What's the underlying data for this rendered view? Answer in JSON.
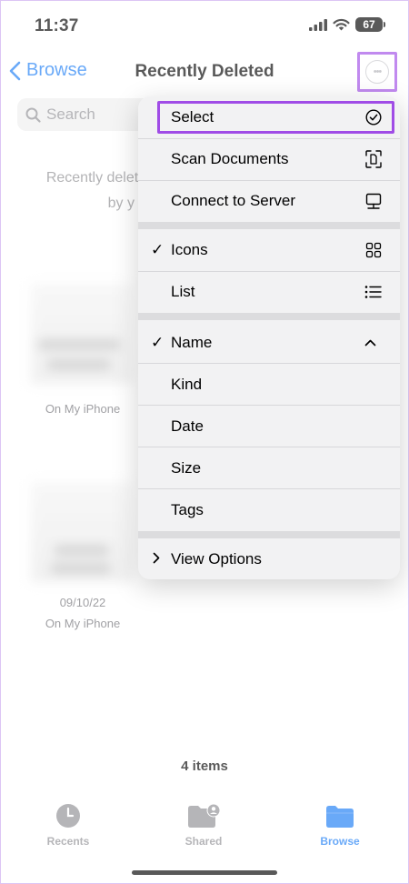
{
  "status": {
    "time": "11:37",
    "battery": "67"
  },
  "nav": {
    "back_label": "Browse",
    "title": "Recently Deleted"
  },
  "search": {
    "placeholder": "Search"
  },
  "background": {
    "info_line1": "Recently deleted",
    "info_line2": "by y",
    "files": [
      {
        "date": "",
        "location": "On My iPhone"
      },
      {
        "date": "09/10/22",
        "location": "On My iPhone"
      }
    ],
    "items_count": "4 items"
  },
  "menu": {
    "actions": [
      {
        "label": "Select",
        "icon": "checkmark-circle-icon"
      },
      {
        "label": "Scan Documents",
        "icon": "doc-scan-icon"
      },
      {
        "label": "Connect to Server",
        "icon": "server-display-icon"
      }
    ],
    "view_modes": [
      {
        "label": "Icons",
        "checked": true,
        "icon": "grid-icon"
      },
      {
        "label": "List",
        "checked": false,
        "icon": "list-icon"
      }
    ],
    "sort": [
      {
        "label": "Name",
        "checked": true,
        "icon": "chevron-up-icon"
      },
      {
        "label": "Kind",
        "checked": false
      },
      {
        "label": "Date",
        "checked": false
      },
      {
        "label": "Size",
        "checked": false
      },
      {
        "label": "Tags",
        "checked": false
      }
    ],
    "view_options": {
      "label": "View Options",
      "icon": "chevron-right-icon"
    },
    "checkmark": "✓"
  },
  "tabs": [
    {
      "label": "Recents",
      "icon": "clock-icon",
      "active": false
    },
    {
      "label": "Shared",
      "icon": "shared-folder-icon",
      "active": false
    },
    {
      "label": "Browse",
      "icon": "folder-icon",
      "active": true
    }
  ],
  "colors": {
    "accent": "#1a7cf5",
    "highlight": "#a04ce6"
  }
}
